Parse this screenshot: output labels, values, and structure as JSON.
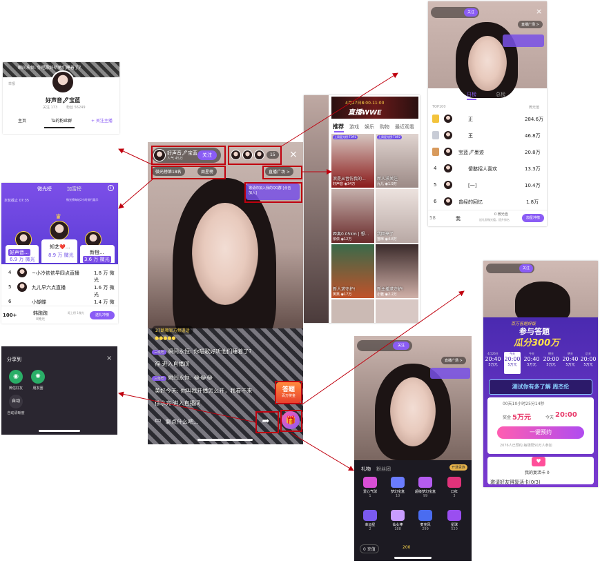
{
  "profile_panel": {
    "host_name": "好声音🖊宝蓝",
    "follow_count": "关注 173",
    "fans_count": "粉丝 56249",
    "tabs": [
      "主页",
      "Ta的粉丝群",
      "+ 关注主播"
    ],
    "top_chat": "瞬间永恒: 你唱歌好听他们睡着了？",
    "report": "举报"
  },
  "rank_panel": {
    "tabs": [
      "微光榜",
      "加富榜"
    ],
    "top_left": "本轮截止 07:35",
    "top_right": "微光榜每轮2小时排行展示",
    "podium": [
      {
        "name": "好声音...",
        "value": "6.9 万 微光"
      },
      {
        "name": "知艺❤️...",
        "value": "8.9 万 微光"
      },
      {
        "name": "新橙...",
        "value": "3.6 万 微光"
      }
    ],
    "rows": [
      {
        "rank": "4",
        "name": "~小冷依依早四点直播",
        "value": "1.8 万 微光"
      },
      {
        "rank": "5",
        "name": "九儿早六点直播",
        "value": "1.6 万 微光"
      },
      {
        "rank": "6",
        "name": "小蝴蝶",
        "value": "1.4 万 微光"
      }
    ],
    "footer_rank": "100+",
    "footer_name": "韩跑跑",
    "footer_sub": "0微光",
    "footer_gap": "距上榜 1微光",
    "footer_btn": "送礼冲榜"
  },
  "share_panel": {
    "title": "分享到",
    "close": "×",
    "items": [
      {
        "label": "微信好友"
      },
      {
        "label": "朋友圈"
      },
      {
        "label": "自动清晰度",
        "short": "自动"
      }
    ]
  },
  "main_live": {
    "host_name": "好声音🖊宝蓝",
    "host_sub": "人气 45万",
    "follow_btn": "关注",
    "rank_tag": "微光榜第18名",
    "week_tag": "周星榜",
    "plaza": "直播广场 >",
    "invite_text": "邀请你加入我的QQ群 [点击加入]",
    "audience": "15",
    "system_msg": "27跳舞官方频道话",
    "chats": [
      {
        "badge": "三级粉",
        "text": "瞬间永恒: 你唱歌好听他们睡着了?"
      },
      {
        "badge": "",
        "text": "福 进入直播间"
      },
      {
        "badge": "三级粉",
        "text": "瞬间永恒: 😂😂😂"
      },
      {
        "badge": "",
        "text": "美好今天: 你叫我开播怎么开，我看不来"
      },
      {
        "badge": "",
        "text": "徐水亮 进入直播间"
      }
    ],
    "input_placeholder": "聊点什么吧...",
    "quiz_label": "答题",
    "quiz_sub": "百万奖金"
  },
  "feed_panel": {
    "banner_title": "4月27日8:00-11:00",
    "banner_sub": "直播WWE",
    "tabs": [
      "推荐",
      "游戏",
      "娱乐",
      "购物",
      "最近观看"
    ],
    "tiles": [
      {
        "tag": "上周星光榜·TOP1",
        "title": "滨是从音仿我的...",
        "user": "好声音",
        "views": "34万"
      },
      {
        "tag": "上周星光榜·TOP2",
        "title": "新人求关注",
        "user": "九儿",
        "views": "1.9万"
      },
      {
        "tag": "",
        "title": "距离0.05km | 想...",
        "user": "依依",
        "views": "12万"
      },
      {
        "tag": "",
        "title": "我回来了",
        "user": "猫咪",
        "views": "4.8万"
      },
      {
        "tag": "",
        "title": "新人求守护!",
        "user": "笑笑",
        "views": "17万"
      },
      {
        "tag": "",
        "title": "新主播求守护!",
        "user": "小雅",
        "views": "2.2万"
      }
    ]
  },
  "guard_panel": {
    "tabs": [
      "日榜",
      "总榜"
    ],
    "col_left": "TOP100",
    "col_right": "微光值",
    "rows": [
      {
        "rank": "1",
        "name": "正",
        "value": "284.6万"
      },
      {
        "rank": "2",
        "name": "王",
        "value": "46.8万"
      },
      {
        "rank": "3",
        "name": "宝蓝🖊墨迹",
        "value": "20.8万"
      },
      {
        "rank": "4",
        "name": "傻憨招人喜欢",
        "value": "13.3万"
      },
      {
        "rank": "5",
        "name": "[一]",
        "value": "10.4万"
      },
      {
        "rank": "6",
        "name": "曾经的回忆",
        "value": "1.8万"
      }
    ],
    "me_rank": "58",
    "me_name": "我",
    "me_value": "0 微光值",
    "me_sub": "送礼即微光值，提升排名",
    "me_btn": "加星冲榜"
  },
  "gift_panel": {
    "tabs": [
      "礼物",
      "粉丝团"
    ],
    "top_btn": "开通贵族",
    "gifts": [
      {
        "name": "爱心气球",
        "price": "1",
        "color": "#d94fd6"
      },
      {
        "name": "梦幻宝盒",
        "price": "10",
        "color": "#6a7cff"
      },
      {
        "name": "超级梦幻宝盒",
        "price": "99",
        "color": "#b45cf0"
      },
      {
        "name": "口红",
        "price": "3",
        "color": "#e0327a"
      },
      {
        "name": "幸运星",
        "price": "2",
        "color": "#7a5af0"
      },
      {
        "name": "仙女棒",
        "price": "188",
        "color": "#c89cff"
      },
      {
        "name": "麦克风",
        "price": "299",
        "color": "#4a6cf0"
      },
      {
        "name": "星球",
        "price": "520",
        "color": "#9a4ef0"
      }
    ],
    "balance": "0 充值",
    "coins": "200"
  },
  "quiz_panel": {
    "top_banner": "百万答题好饭",
    "title": "参与答题",
    "prize": "瓜分300万",
    "times": [
      {
        "date": "4月26日",
        "time": "20:40",
        "amount": "5万元"
      },
      {
        "date": "今天",
        "time": "20:00",
        "amount": "5万元"
      },
      {
        "date": "今天",
        "time": "20:40",
        "amount": "5万元"
      },
      {
        "date": "明天",
        "time": "20:00",
        "amount": "5万元"
      },
      {
        "date": "明天",
        "time": "20:40",
        "amount": "5万元"
      },
      {
        "date": "后天",
        "time": "20:00",
        "amount": "5万元"
      }
    ],
    "ad": "测试你有多了解 周杰伦",
    "countdown": "00天10小时25分14秒",
    "prize_label": "奖金",
    "prize_amount": "5万元",
    "today_label": "今天",
    "today_time": "20:00",
    "reserve_btn": "一键预约",
    "reserved": "2076人已预约,每场限50万人参加",
    "revive": "我的复活卡 0",
    "invite": "邀请好友得复活卡(0/3)"
  },
  "colors": {
    "accent": "#8a5cf5",
    "highlight": "#c0000e"
  }
}
